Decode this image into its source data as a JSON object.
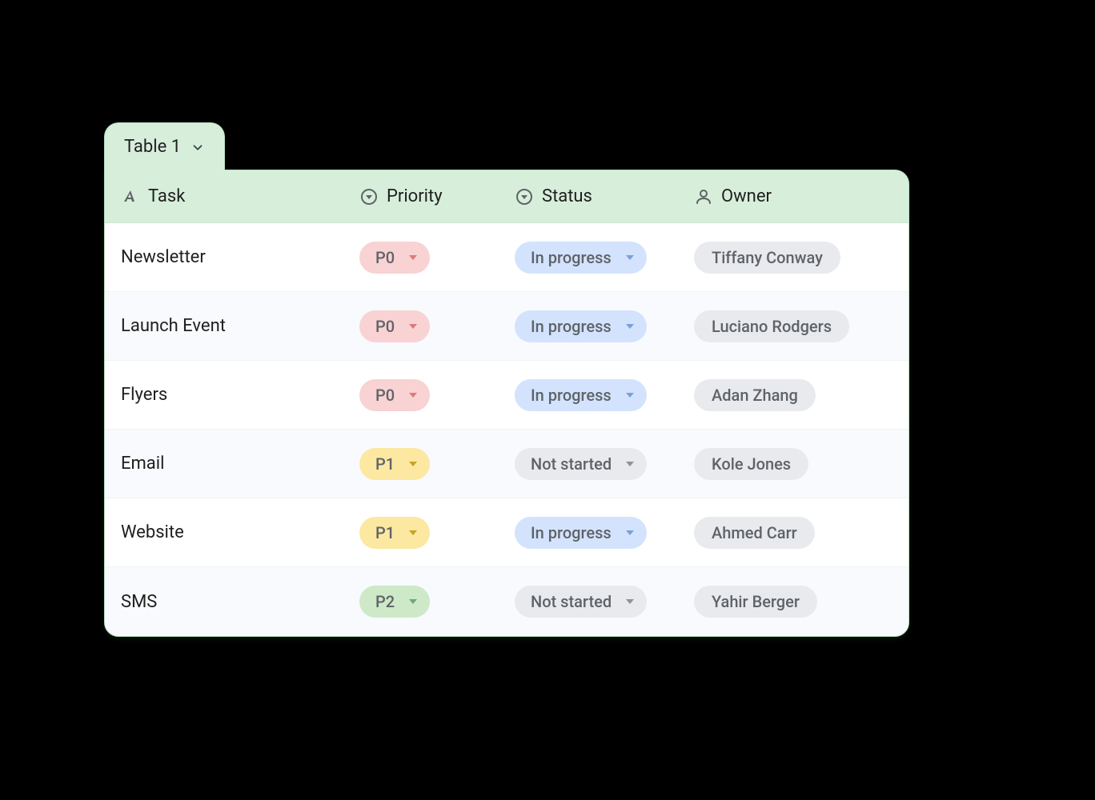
{
  "colors": {
    "accent_green_bg": "#d7eedb",
    "accent_green_border": "#b7e0bf",
    "pill_red": "#f9d2d3",
    "pill_yellow": "#fce8a0",
    "pill_green": "#cde9c8",
    "pill_blue": "#d3e3fd",
    "pill_grey": "#e8eaed",
    "row_alt": "#f8fafd",
    "text_primary": "#1f1f1f",
    "text_muted": "#5f6368"
  },
  "tab": {
    "label": "Table 1",
    "icon": "chevron-down-icon"
  },
  "headers": {
    "task": {
      "label": "Task",
      "icon": "text-format-icon"
    },
    "priority": {
      "label": "Priority",
      "icon": "circle-dropdown-icon"
    },
    "status": {
      "label": "Status",
      "icon": "circle-dropdown-icon"
    },
    "owner": {
      "label": "Owner",
      "icon": "person-icon"
    }
  },
  "rows": [
    {
      "task": "Newsletter",
      "priority": {
        "value": "P0",
        "variant": "red"
      },
      "status": {
        "value": "In progress",
        "variant": "blue"
      },
      "owner": "Tiffany Conway"
    },
    {
      "task": "Launch Event",
      "priority": {
        "value": "P0",
        "variant": "red"
      },
      "status": {
        "value": "In progress",
        "variant": "blue"
      },
      "owner": "Luciano Rodgers"
    },
    {
      "task": "Flyers",
      "priority": {
        "value": "P0",
        "variant": "red"
      },
      "status": {
        "value": "In progress",
        "variant": "blue"
      },
      "owner": "Adan Zhang"
    },
    {
      "task": "Email",
      "priority": {
        "value": "P1",
        "variant": "yellow"
      },
      "status": {
        "value": "Not started",
        "variant": "grey"
      },
      "owner": "Kole Jones"
    },
    {
      "task": "Website",
      "priority": {
        "value": "P1",
        "variant": "yellow"
      },
      "status": {
        "value": "In progress",
        "variant": "blue"
      },
      "owner": "Ahmed Carr"
    },
    {
      "task": "SMS",
      "priority": {
        "value": "P2",
        "variant": "green"
      },
      "status": {
        "value": "Not started",
        "variant": "grey"
      },
      "owner": "Yahir Berger"
    }
  ]
}
